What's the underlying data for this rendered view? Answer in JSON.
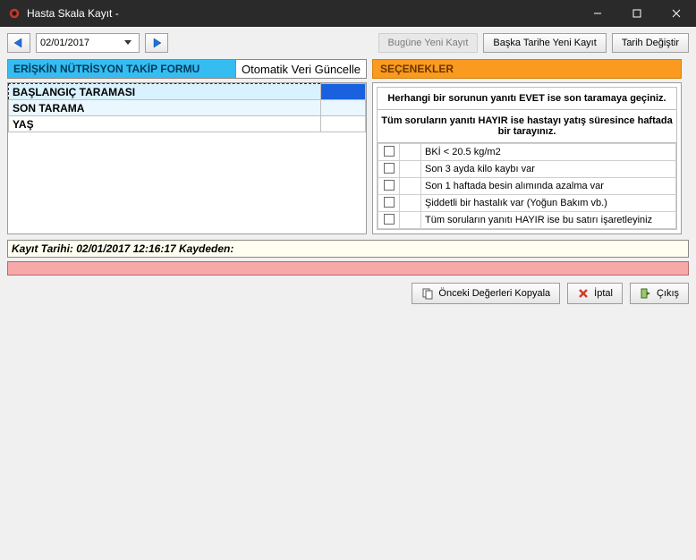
{
  "window": {
    "title": "Hasta Skala Kayıt -"
  },
  "toolbar": {
    "date_value": "02/01/2017",
    "today_new": "Bugüne Yeni Kayıt",
    "other_date_new": "Başka Tarihe Yeni Kayıt",
    "change_date": "Tarih Değiştir"
  },
  "left_panel": {
    "title": "ERİŞKİN NÜTRİSYON TAKİP FORMU",
    "auto_update": "Otomatik Veri Güncelle",
    "rows": [
      {
        "label": "BAŞLANGIÇ TARAMASI",
        "value": ""
      },
      {
        "label": "SON TARAMA",
        "value": ""
      },
      {
        "label": "YAŞ",
        "value": ""
      }
    ]
  },
  "right_panel": {
    "title": "SEÇENEKLER",
    "caption1": "Herhangi bir sorunun yanıtı EVET ise son taramaya geçiniz.",
    "caption2": "Tüm soruların yanıtı HAYIR ise hastayı yatış süresince haftada bir tarayınız.",
    "options": [
      "BKİ < 20.5 kg/m2",
      "Son 3 ayda kilo kaybı var",
      "Son 1 haftada besin alımında azalma var",
      "Şiddetli bir hastalık var (Yoğun Bakım vb.)",
      "Tüm soruların  yanıtı HAYIR ise bu satırı işaretleyiniz"
    ]
  },
  "status": {
    "text": "Kayıt Tarihi: 02/01/2017 12:16:17   Kaydeden:"
  },
  "buttons": {
    "copy_prev": "Önceki Değerleri Kopyala",
    "cancel": "İptal",
    "exit": "Çıkış"
  }
}
